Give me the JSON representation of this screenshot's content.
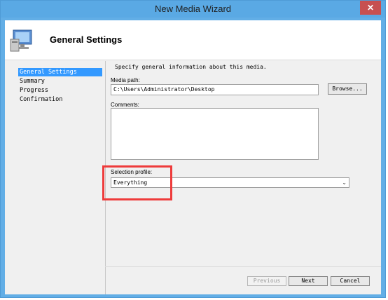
{
  "window": {
    "title": "New Media Wizard",
    "close_glyph": "✕"
  },
  "header": {
    "title": "General Settings",
    "icon": "computer-icon"
  },
  "nav": {
    "items": [
      {
        "label": "General Settings"
      },
      {
        "label": "Summary"
      },
      {
        "label": "Progress"
      },
      {
        "label": "Confirmation"
      }
    ]
  },
  "main": {
    "description": "Specify general information about this media.",
    "media_path": {
      "label": "Media path:",
      "value": "C:\\Users\\Administrator\\Desktop",
      "browse_label": "Browse..."
    },
    "comments": {
      "label": "Comments:",
      "value": ""
    },
    "selection_profile": {
      "label": "Selection profile:",
      "value": "Everything"
    }
  },
  "footer": {
    "previous_label": "Previous",
    "next_label": "Next",
    "cancel_label": "Cancel"
  },
  "colors": {
    "accent": "#3399ff",
    "highlight": "#ee3b3b",
    "titlebar": "#5aa9e4",
    "close": "#c75050"
  }
}
